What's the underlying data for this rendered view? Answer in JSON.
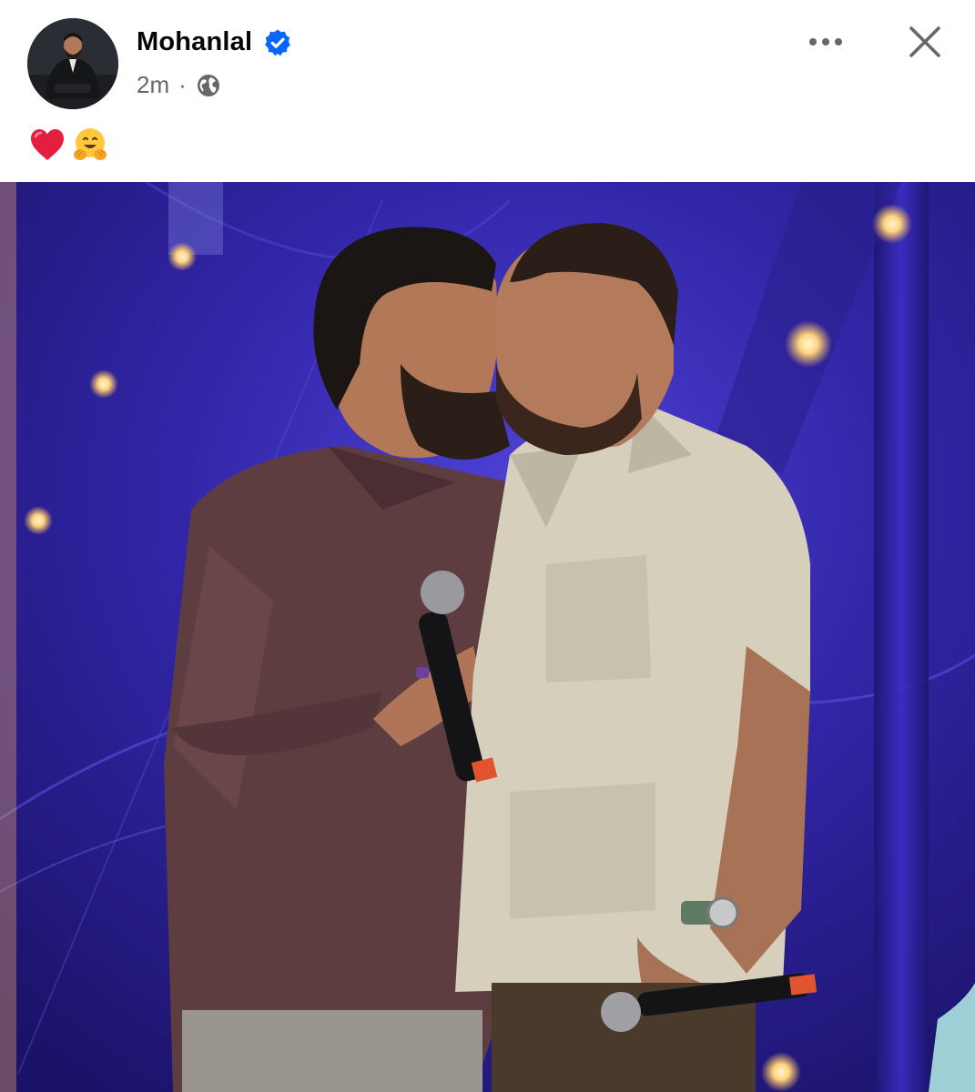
{
  "post": {
    "author": "Mohanlal",
    "verified": true,
    "timestamp": "2m",
    "separator": "·",
    "audience_icon": "globe-icon",
    "caption_emojis": [
      "heart-emoji",
      "hugging-face-emoji"
    ],
    "actions": {
      "more_icon": "more-horizontal-icon",
      "close_icon": "close-icon"
    }
  },
  "colors": {
    "verified_badge": "#0866ff",
    "secondary_text": "#65676b",
    "primary_text": "#050505",
    "heart": "#e41e3f",
    "stage_background": "#2b1f8f"
  }
}
